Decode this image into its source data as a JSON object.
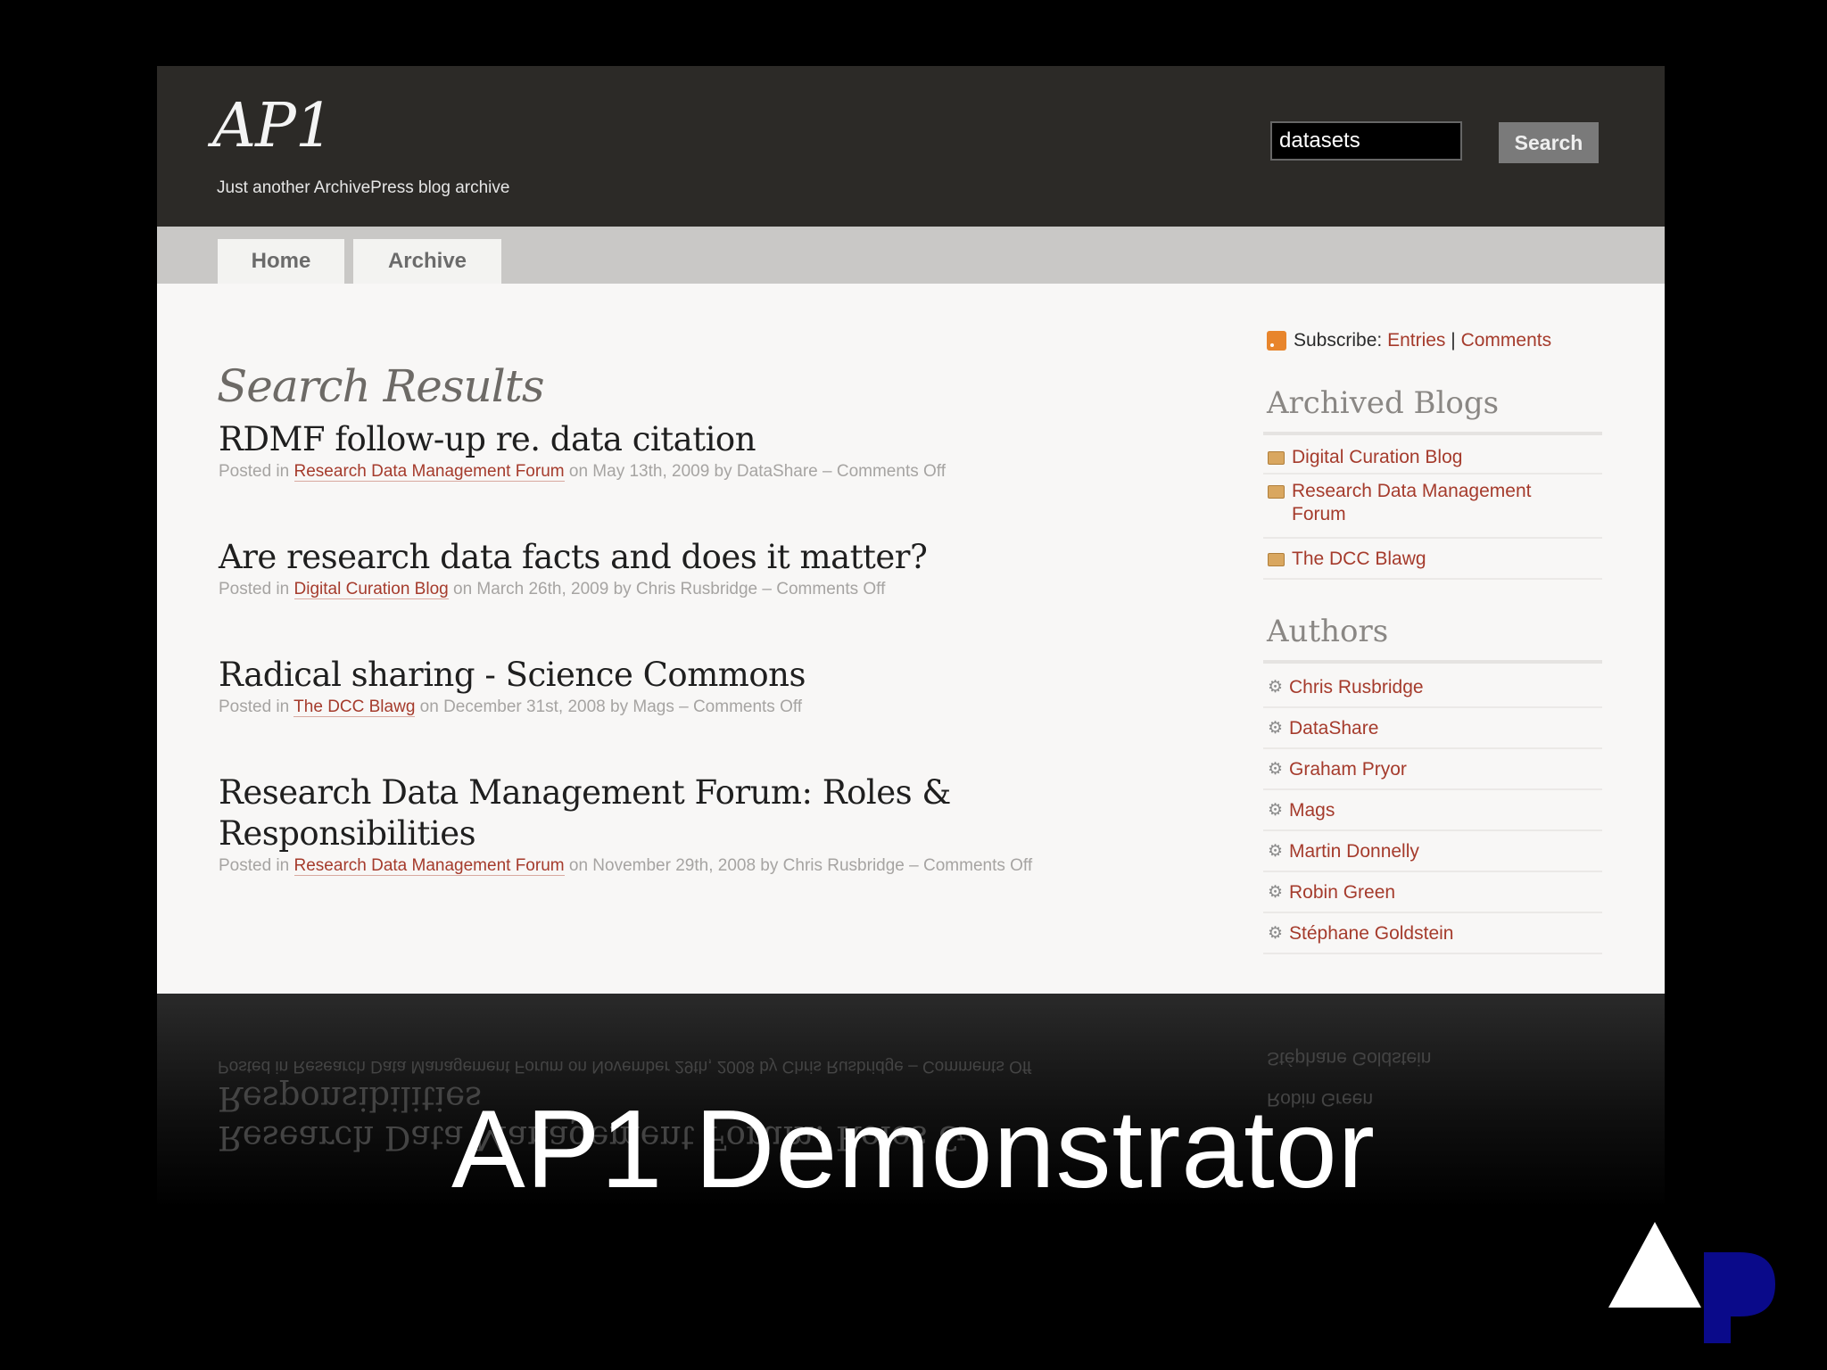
{
  "site": {
    "title": "AP1",
    "tagline": "Just another ArchivePress blog archive",
    "search": {
      "value": "datasets",
      "button_label": "Search"
    },
    "nav": {
      "tabs": [
        "Home",
        "Archive"
      ]
    }
  },
  "main": {
    "heading": "Search Results",
    "posts": [
      {
        "title": "RDMF follow-up re. data citation",
        "posted_in": "Posted in",
        "category": "Research Data Management Forum",
        "details": "on May 13th, 2009 by DataShare – Comments Off"
      },
      {
        "title": "Are research data facts and does it matter?",
        "posted_in": "Posted in",
        "category": "Digital Curation Blog",
        "details": "on March 26th, 2009 by Chris Rusbridge – Comments Off"
      },
      {
        "title": "Radical sharing - Science Commons",
        "posted_in": "Posted in",
        "category": "The DCC Blawg",
        "details": "on December 31st, 2008 by Mags – Comments Off"
      },
      {
        "title_line1": "Research Data Management Forum: Roles &",
        "title_line2": "Responsibilities",
        "posted_in": "Posted in",
        "category": "Research Data Management Forum",
        "details": "on November 29th, 2008 by Chris Rusbridge – Comments Off"
      }
    ]
  },
  "sidebar": {
    "subscribe": {
      "label": "Subscribe:",
      "entries": "Entries",
      "separator": "|",
      "comments": "Comments"
    },
    "archived_blogs": {
      "title": "Archived Blogs",
      "items": [
        "Digital Curation Blog",
        "Research Data Management",
        "Forum",
        "The DCC Blawg"
      ]
    },
    "authors": {
      "title": "Authors",
      "items": [
        "Chris Rusbridge",
        "DataShare",
        "Graham Pryor",
        "Mags",
        "Martin Donnelly",
        "Robin Green",
        "Stéphane Goldstein"
      ]
    }
  },
  "reflection": {
    "meta": "Posted in Research Data Management Forum on November 29th, 2008 by Chris Rusbridge – Comments Off",
    "line2": "Responsibilities",
    "line1": "Research Data Management Forum: Roles &",
    "author1": "Stéphane Goldstein",
    "author2": "Robin Green"
  },
  "slide": {
    "caption": "AP1 Demonstrator"
  },
  "colors": {
    "header_bg": "#2c2a27",
    "link": "#a53b2c",
    "logo_white": "#ffffff",
    "logo_blue": "#0a0a8a"
  }
}
